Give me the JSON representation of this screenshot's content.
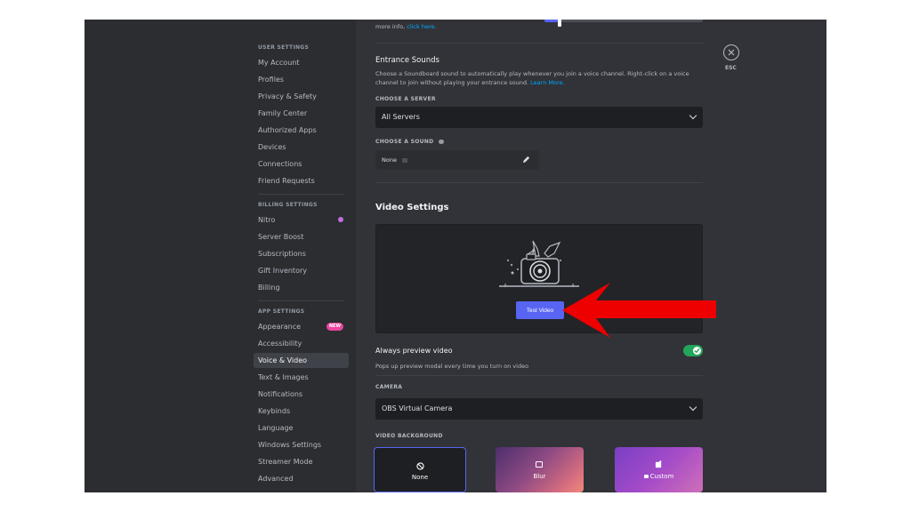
{
  "sidebar": {
    "user_settings_header": "USER SETTINGS",
    "user_items": [
      "My Account",
      "Profiles",
      "Privacy & Safety",
      "Family Center",
      "Authorized Apps",
      "Devices",
      "Connections",
      "Friend Requests"
    ],
    "billing_settings_header": "BILLING SETTINGS",
    "billing_items": [
      "Nitro",
      "Server Boost",
      "Subscriptions",
      "Gift Inventory",
      "Billing"
    ],
    "app_settings_header": "APP SETTINGS",
    "app_items": [
      "Appearance",
      "Accessibility",
      "Voice & Video",
      "Text & Images",
      "Notifications",
      "Keybinds",
      "Language",
      "Windows Settings",
      "Streamer Mode",
      "Advanced"
    ],
    "new_badge": "NEW",
    "active_item": "Voice & Video"
  },
  "content": {
    "top_more_info_prefix": "more info,",
    "top_more_info_link": "click here.",
    "entrance": {
      "title": "Entrance Sounds",
      "description": "Choose a Soundboard sound to automatically play whenever you join a voice channel. Right-click on a voice channel to join without playing your entrance sound.",
      "learn_more": "Learn More.",
      "choose_server_label": "CHOOSE A SERVER",
      "server_value": "All Servers",
      "choose_sound_label": "CHOOSE A SOUND",
      "sound_value": "None"
    },
    "video": {
      "title": "Video Settings",
      "test_button": "Test Video",
      "always_preview_title": "Always preview video",
      "always_preview_desc": "Pops up preview modal every time you turn on video",
      "always_preview_on": true,
      "camera_label": "CAMERA",
      "camera_value": "OBS Virtual Camera",
      "background_label": "VIDEO BACKGROUND",
      "bg_options": [
        "None",
        "Blur",
        "Custom"
      ]
    }
  },
  "close": {
    "esc_label": "ESC"
  },
  "colors": {
    "accent": "#5865f2",
    "toggle_on": "#23a55a",
    "arrow": "#ee0000",
    "link": "#00a8fc"
  }
}
